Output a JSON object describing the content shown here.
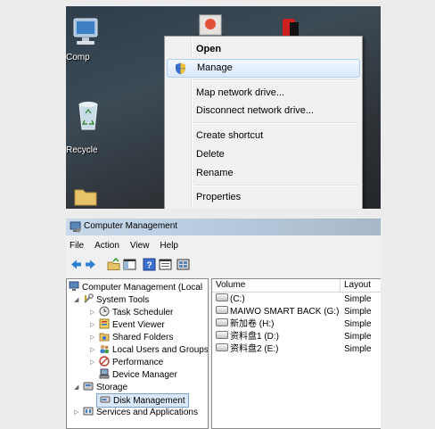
{
  "desktop": {
    "icons": [
      {
        "label": "Comp"
      },
      {
        "label": "Recycle"
      }
    ]
  },
  "context_menu": {
    "items": [
      {
        "label": "Open",
        "bold": true
      },
      {
        "label": "Manage",
        "highlighted": true,
        "icon": "uac-shield-icon"
      },
      {
        "label": "Map network drive..."
      },
      {
        "label": "Disconnect network drive..."
      },
      {
        "label": "Create shortcut"
      },
      {
        "label": "Delete"
      },
      {
        "label": "Rename"
      },
      {
        "label": "Properties"
      }
    ]
  },
  "window": {
    "title": "Computer Management",
    "menu": [
      "File",
      "Action",
      "View",
      "Help"
    ],
    "toolbar_icons": [
      "back-arrow-icon",
      "forward-arrow-icon",
      "up-folder-icon",
      "show-hide-tree-icon",
      "help-icon",
      "properties-icon",
      "console-icon"
    ],
    "tree": {
      "root": "Computer Management (Local",
      "system_tools": "System Tools",
      "task_scheduler": "Task Scheduler",
      "event_viewer": "Event Viewer",
      "shared_folders": "Shared Folders",
      "local_users": "Local Users and Groups",
      "performance": "Performance",
      "device_manager": "Device Manager",
      "storage": "Storage",
      "disk_management": "Disk Management",
      "services": "Services and Applications"
    },
    "list": {
      "columns": [
        "Volume",
        "Layout"
      ],
      "rows": [
        {
          "volume": "(C:)",
          "layout": "Simple"
        },
        {
          "volume": "MAIWO SMART BACK (G:)",
          "layout": "Simple"
        },
        {
          "volume": "新加卷 (H:)",
          "layout": "Simple"
        },
        {
          "volume": "资料盘1 (D:)",
          "layout": "Simple"
        },
        {
          "volume": "资料盘2 (E:)",
          "layout": "Simple"
        }
      ]
    }
  },
  "colors": {
    "menu_highlight": "#d9e8fb",
    "desktop_bg": "#2f3e4c",
    "titlebar": "#c9d9ea"
  }
}
